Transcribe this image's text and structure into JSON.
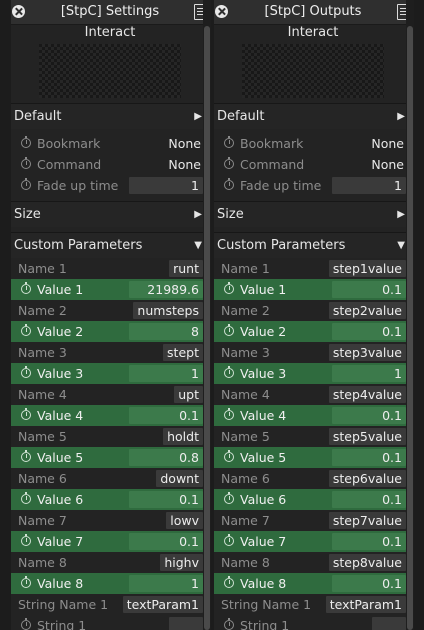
{
  "panels": [
    {
      "title": "[StpC] Settings",
      "interact_label": "Interact",
      "default_section": "Default",
      "bookmark_label": "Bookmark",
      "bookmark_value": "None",
      "command_label": "Command",
      "command_value": "None",
      "fade_label": "Fade up time",
      "fade_value": "1",
      "size_section": "Size",
      "custom_section": "Custom Parameters",
      "params": [
        {
          "name_label": "Name 1",
          "name_value": "runt",
          "value_label": "Value 1",
          "value": "21989.6"
        },
        {
          "name_label": "Name 2",
          "name_value": "numsteps",
          "value_label": "Value 2",
          "value": "8"
        },
        {
          "name_label": "Name 3",
          "name_value": "stept",
          "value_label": "Value 3",
          "value": "1"
        },
        {
          "name_label": "Name 4",
          "name_value": "upt",
          "value_label": "Value 4",
          "value": "0.1"
        },
        {
          "name_label": "Name 5",
          "name_value": "holdt",
          "value_label": "Value 5",
          "value": "0.8"
        },
        {
          "name_label": "Name 6",
          "name_value": "downt",
          "value_label": "Value 6",
          "value": "0.1"
        },
        {
          "name_label": "Name 7",
          "name_value": "lowv",
          "value_label": "Value 7",
          "value": "0.1"
        },
        {
          "name_label": "Name 8",
          "name_value": "highv",
          "value_label": "Value 8",
          "value": "1"
        }
      ],
      "string_name_label": "String Name 1",
      "string_name_value": "textParam1",
      "string_label": "String 1",
      "string_value": ""
    },
    {
      "title": "[StpC] Outputs",
      "interact_label": "Interact",
      "default_section": "Default",
      "bookmark_label": "Bookmark",
      "bookmark_value": "None",
      "command_label": "Command",
      "command_value": "None",
      "fade_label": "Fade up time",
      "fade_value": "1",
      "size_section": "Size",
      "custom_section": "Custom Parameters",
      "params": [
        {
          "name_label": "Name 1",
          "name_value": "step1value",
          "value_label": "Value 1",
          "value": "0.1"
        },
        {
          "name_label": "Name 2",
          "name_value": "step2value",
          "value_label": "Value 2",
          "value": "0.1"
        },
        {
          "name_label": "Name 3",
          "name_value": "step3value",
          "value_label": "Value 3",
          "value": "1"
        },
        {
          "name_label": "Name 4",
          "name_value": "step4value",
          "value_label": "Value 4",
          "value": "0.1"
        },
        {
          "name_label": "Name 5",
          "name_value": "step5value",
          "value_label": "Value 5",
          "value": "0.1"
        },
        {
          "name_label": "Name 6",
          "name_value": "step6value",
          "value_label": "Value 6",
          "value": "0.1"
        },
        {
          "name_label": "Name 7",
          "name_value": "step7value",
          "value_label": "Value 7",
          "value": "0.1"
        },
        {
          "name_label": "Name 8",
          "name_value": "step8value",
          "value_label": "Value 8",
          "value": "0.1"
        }
      ],
      "string_name_label": "String Name 1",
      "string_name_value": "textParam1",
      "string_label": "String 1",
      "string_value": ""
    }
  ],
  "icons": {
    "close": "close-icon",
    "edit": "edit-icon",
    "timer": "timer-icon",
    "collapsed_arrow": "▶",
    "expanded_arrow": "▼"
  },
  "colors": {
    "background": "#1c1c1c",
    "panel": "#232323",
    "value_row": "#2f6b3e",
    "field": "#3a3a3a"
  }
}
